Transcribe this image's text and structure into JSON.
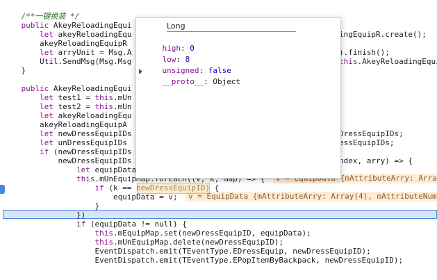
{
  "code_lines": [
    {
      "text": "    /**一键换装 */",
      "kind": "comment"
    },
    {
      "text": "    public AkeyReloadingEqui",
      "tail": "",
      "kind": "normal"
    },
    {
      "text": "        let akeyReloadingEqu",
      "right": "ingEquipR.create();"
    },
    {
      "text": "        akeyReloadingEquipR"
    },
    {
      "text": "        let arryUnit = Msg.A",
      "right": ").finish();"
    },
    {
      "text": "        Util.SendMsg(Msg.Msg",
      "right": "this.AkeyReloadingEqui"
    },
    {
      "text": "    }"
    },
    {
      "text": ""
    },
    {
      "text": "    public AkeyReloadingEqui"
    },
    {
      "text": "        let test1 = this.mUn"
    },
    {
      "text": "        let test2 = this.mUn"
    },
    {
      "text": "        let akeyReloadingEqu"
    },
    {
      "text": "        akeyReloadingEquipA"
    },
    {
      "text": "        let newDressEquipIDs",
      "right": "DressEquipIDs;"
    },
    {
      "text": "        let unDressEquipIDs",
      "right": "essEquipIDs;"
    },
    {
      "text": "        if (newDressEquipIDs"
    },
    {
      "text": "            newDressEquipIDs",
      "right": "ndex, arry) => {"
    },
    {
      "text": "                let equipData"
    },
    {
      "text": "                this.mUnEquipMap.forEach((v, k, map) => {"
    },
    {
      "text": "                    if (k == newDressEquipID) {"
    },
    {
      "text": "                        equipData = v;"
    },
    {
      "text": "                    }"
    },
    {
      "text": "                })"
    },
    {
      "text": "                if (equipData != null) {"
    },
    {
      "text": "                    this.mEquipMap.set(newDressEquipID, equipData);"
    },
    {
      "text": "                    this.mUnEquipMap.delete(newDressEquipID);"
    },
    {
      "text": "                    EventDispatch.emit(TEventType.EDressEquip, newDressEquipID);"
    },
    {
      "text": "                    EventDispatch.emit(TEventType.EPopItemByBackpack, newDressEquipID);"
    }
  ],
  "inline_values": {
    "foreach_value": "v = EquipData {mAttributeArry: Arra",
    "assign_value": "v = EquipData {mAttributeArry: Array(4), mAttributeNum"
  },
  "popover": {
    "title": "Long",
    "props": [
      {
        "name": "high",
        "value": "0"
      },
      {
        "name": "low",
        "value": "8"
      },
      {
        "name": "unsigned",
        "value": "false"
      }
    ],
    "proto_name": "__proto__",
    "proto_value": "Object"
  },
  "colors": {
    "keyword": "#881391",
    "comment": "#236e25",
    "highlight": "#d6e7fb",
    "inline_bg": "#fdebd6"
  }
}
